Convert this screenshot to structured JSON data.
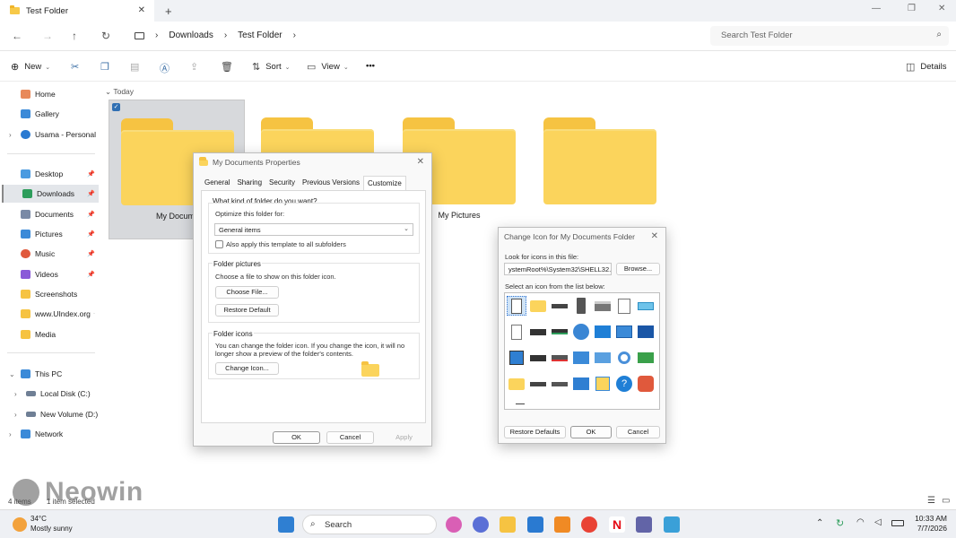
{
  "window": {
    "tab_title": "Test Folder",
    "tab_close": "✕",
    "new_tab": "+",
    "min": "—",
    "max": "❐",
    "close": "✕"
  },
  "address": {
    "crumbs": [
      "Downloads",
      "Test Folder"
    ],
    "search_placeholder": "Search Test Folder"
  },
  "toolbar": {
    "new_label": "New",
    "sort_label": "Sort",
    "view_label": "View",
    "more": "•••",
    "details_label": "Details"
  },
  "sidebar": {
    "items": [
      {
        "label": "Home",
        "color": "#e8895a"
      },
      {
        "label": "Gallery",
        "color": "#3b8ad8"
      },
      {
        "label": "Usama - Personal",
        "color": "#2a7ad1"
      },
      {
        "label": "Desktop",
        "color": "#4b9be0"
      },
      {
        "label": "Downloads",
        "color": "#2d9d5b"
      },
      {
        "label": "Documents",
        "color": "#7a8aa6"
      },
      {
        "label": "Pictures",
        "color": "#3b8ad8"
      },
      {
        "label": "Music",
        "color": "#e0593c"
      },
      {
        "label": "Videos",
        "color": "#8a5ad8"
      },
      {
        "label": "Screenshots",
        "color": "#f6c342"
      },
      {
        "label": "www.UIndex.org",
        "color": "#f6c342"
      },
      {
        "label": "Media",
        "color": "#f6c342"
      },
      {
        "label": "This PC",
        "color": "#3b8ad8"
      },
      {
        "label": "Local Disk (C:)",
        "color": "#6f7f95"
      },
      {
        "label": "New Volume (D:)",
        "color": "#6f7f95"
      },
      {
        "label": "Network",
        "color": "#3b8ad8"
      }
    ]
  },
  "content": {
    "group_header": "Today",
    "folders": [
      "My Docume",
      "",
      "My Pictures",
      ""
    ]
  },
  "status": {
    "items_count": "4 items",
    "selected": "1 item selected"
  },
  "properties_dialog": {
    "title": "My Documents Properties",
    "tabs": [
      "General",
      "Sharing",
      "Security",
      "Previous Versions",
      "Customize"
    ],
    "q_label": "What kind of folder do you want?",
    "optimize_label": "Optimize this folder for:",
    "optimize_value": "General items",
    "apply_template": "Also apply this template to all subfolders",
    "pictures_heading": "Folder pictures",
    "pictures_text": "Choose a file to show on this folder icon.",
    "choose_file": "Choose File...",
    "restore_default": "Restore Default",
    "icons_heading": "Folder icons",
    "icons_text_1": "You can change the folder icon. If you change the icon, it will no",
    "icons_text_2": "longer show a preview of the folder's contents.",
    "change_icon": "Change Icon...",
    "ok": "OK",
    "cancel": "Cancel",
    "apply": "Apply"
  },
  "change_icon_dialog": {
    "title": "Change Icon for My Documents Folder",
    "look_label": "Look for icons in this file:",
    "file_value": "ystemRoot%\\System32\\SHELL32.dll",
    "browse": "Browse...",
    "select_label": "Select an icon from the list below:",
    "restore_defaults": "Restore Defaults",
    "ok": "OK",
    "cancel": "Cancel"
  },
  "taskbar": {
    "weather_temp": "34°C",
    "weather_text": "Mostly sunny",
    "search_label": "Search",
    "time": "10:33 AM",
    "date": "7/7/2026"
  },
  "watermark": "Neowin"
}
